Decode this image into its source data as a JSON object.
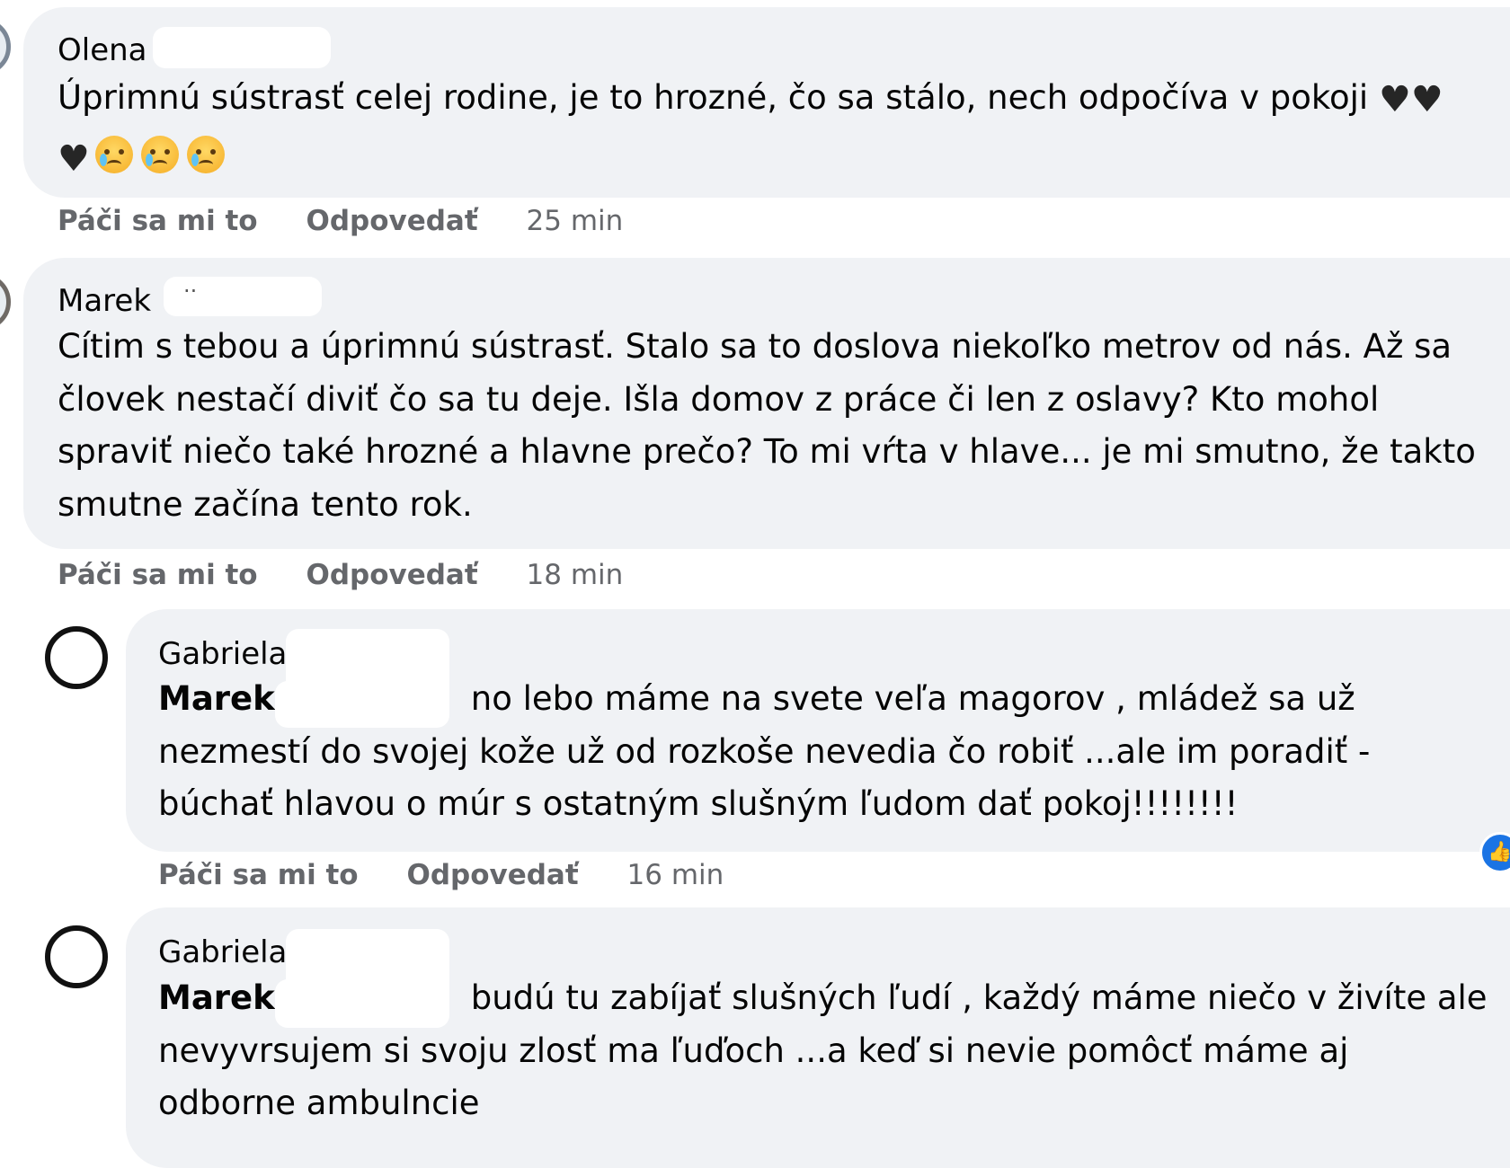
{
  "comments": [
    {
      "author": "Olena",
      "lines": [
        "Úprimnú sústrasť celej rodine, je to hrozné, čo sa stálo, nech odpočíva v pokoji"
      ],
      "emoji_line": [
        "black-heart",
        "crying-face",
        "crying-face",
        "crying-face"
      ],
      "actions": {
        "like": "Páči sa mi to",
        "reply": "Odpovedať",
        "time": "25 min"
      }
    },
    {
      "author": "Marek",
      "author_suffix": "··",
      "lines": [
        "Cítim s tebou a úprimnú sústrasť. Stalo sa to doslova niekoľko metrov od nás. Až sa",
        "človek nestačí diviť čo sa tu deje. Išla domov z práce či len z oslavy? Kto mohol",
        "spraviť niečo také hrozné a hlavne prečo? To mi vŕta v hlave... je mi smutno, že takto",
        "smutne začína tento rok."
      ],
      "actions": {
        "like": "Páči sa mi to",
        "reply": "Odpovedať",
        "time": "18 min"
      }
    }
  ],
  "replies": [
    {
      "author": "Gabriela",
      "mention": "Marek",
      "lines": [
        "no lebo máme na svete veľa magorov , mládež sa už",
        "nezmestí do svojej kože už od rozkoše nevedia čo robiť ...ale im poradiť -",
        "búchať hlavou o múr s ostatným slušným ľudom dať pokoj!!!!!!!!"
      ],
      "actions": {
        "like": "Páči sa mi to",
        "reply": "Odpovedať",
        "time": "16 min"
      },
      "reaction": "like-icon"
    },
    {
      "author": "Gabriela",
      "mention": "Marek",
      "lines": [
        "budú tu zabíjať slušných ľudí , každý máme niečo v živíte ale",
        "nevyvrsujem si svoju zlosť ma ľuďoch ...a keď si nevie pomôcť máme aj",
        "odborne ambulncie"
      ]
    }
  ],
  "colors": {
    "bubble": "#f0f2f5",
    "text": "#050505",
    "secondary": "#65676b",
    "like_blue": "#1b74e4"
  }
}
